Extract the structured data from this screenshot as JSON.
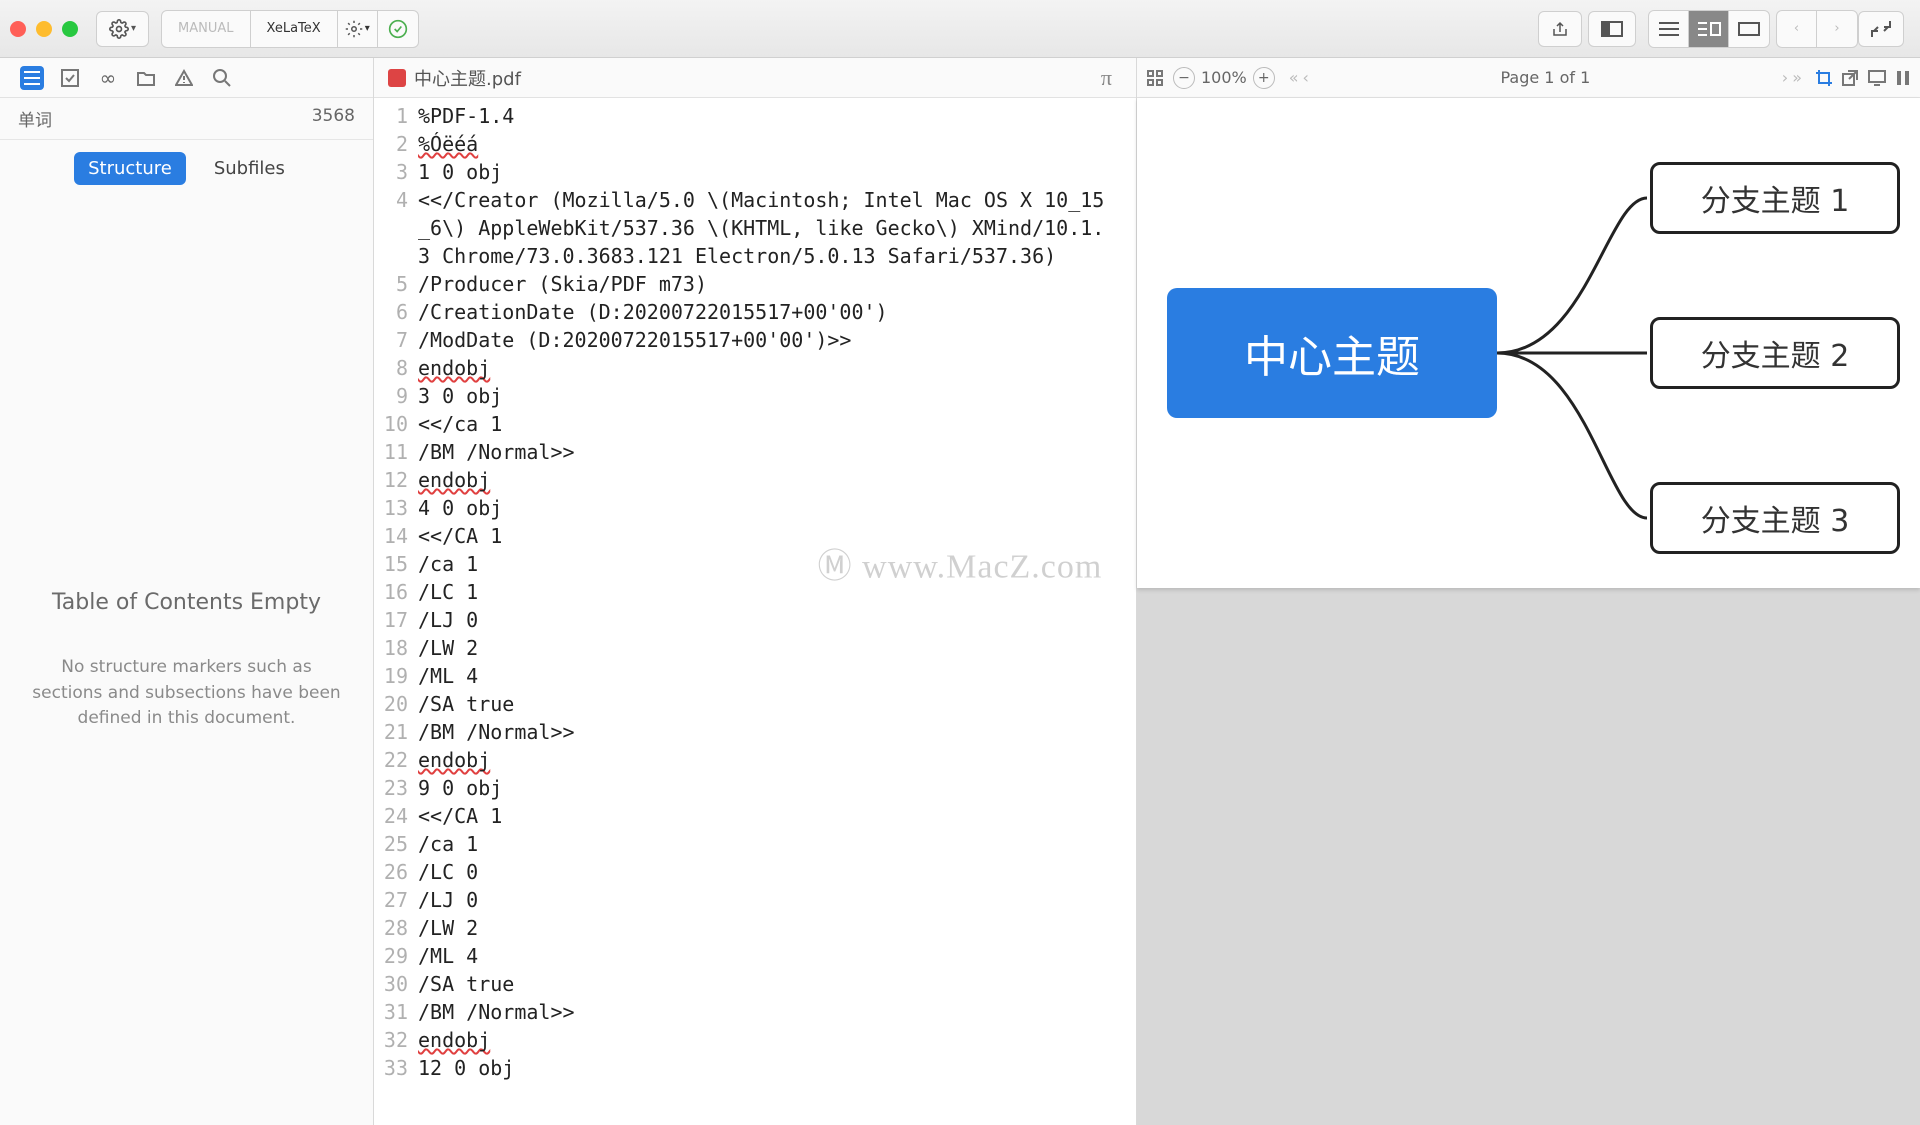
{
  "toolbar": {
    "manual": "MANUAL",
    "engine": "XeLaTeX"
  },
  "sidebar": {
    "word_label": "单词",
    "word_count": "3568",
    "tab_structure": "Structure",
    "tab_subfiles": "Subfiles",
    "empty_title": "Table of Contents Empty",
    "empty_body": "No structure markers such as sections and subsections have been defined in this document."
  },
  "editor": {
    "filename": "中心主题.pdf",
    "pi_symbol": "π",
    "lines": [
      {
        "n": "1",
        "t": "%PDF-1.4",
        "sq": false
      },
      {
        "n": "2",
        "t": "%Óëéá",
        "sq": true
      },
      {
        "n": "3",
        "t": "1 0 obj",
        "sq": false
      },
      {
        "n": "4",
        "t": "<</Creator (Mozilla/5.0 \\(Macintosh; Intel Mac OS X 10_15_6\\) AppleWebKit/537.36 \\(KHTML, like Gecko\\) XMind/10.1.3 Chrome/73.0.3683.121 Electron/5.0.13 Safari/537.36)",
        "sq": false
      },
      {
        "n": "5",
        "t": "/Producer (Skia/PDF m73)",
        "sq": false
      },
      {
        "n": "6",
        "t": "/CreationDate (D:20200722015517+00'00')",
        "sq": false
      },
      {
        "n": "7",
        "t": "/ModDate (D:20200722015517+00'00')>>",
        "sq": false
      },
      {
        "n": "8",
        "t": "endobj",
        "sq": true
      },
      {
        "n": "9",
        "t": "3 0 obj",
        "sq": false
      },
      {
        "n": "10",
        "t": "<</ca 1",
        "sq": false
      },
      {
        "n": "11",
        "t": "/BM /Normal>>",
        "sq": false
      },
      {
        "n": "12",
        "t": "endobj",
        "sq": true
      },
      {
        "n": "13",
        "t": "4 0 obj",
        "sq": false
      },
      {
        "n": "14",
        "t": "<</CA 1",
        "sq": false
      },
      {
        "n": "15",
        "t": "/ca 1",
        "sq": false
      },
      {
        "n": "16",
        "t": "/LC 1",
        "sq": false
      },
      {
        "n": "17",
        "t": "/LJ 0",
        "sq": false
      },
      {
        "n": "18",
        "t": "/LW 2",
        "sq": false
      },
      {
        "n": "19",
        "t": "/ML 4",
        "sq": false
      },
      {
        "n": "20",
        "t": "/SA true",
        "sq": false
      },
      {
        "n": "21",
        "t": "/BM /Normal>>",
        "sq": false
      },
      {
        "n": "22",
        "t": "endobj",
        "sq": true
      },
      {
        "n": "23",
        "t": "9 0 obj",
        "sq": false
      },
      {
        "n": "24",
        "t": "<</CA 1",
        "sq": false
      },
      {
        "n": "25",
        "t": "/ca 1",
        "sq": false
      },
      {
        "n": "26",
        "t": "/LC 0",
        "sq": false
      },
      {
        "n": "27",
        "t": "/LJ 0",
        "sq": false
      },
      {
        "n": "28",
        "t": "/LW 2",
        "sq": false
      },
      {
        "n": "29",
        "t": "/ML 4",
        "sq": false
      },
      {
        "n": "30",
        "t": "/SA true",
        "sq": false
      },
      {
        "n": "31",
        "t": "/BM /Normal>>",
        "sq": false
      },
      {
        "n": "32",
        "t": "endobj",
        "sq": true
      },
      {
        "n": "33",
        "t": "12 0 obj",
        "sq": false
      }
    ]
  },
  "preview": {
    "zoom": "100%",
    "page_text": "Page 1 of 1",
    "central": "中心主题",
    "branches": [
      "分支主题 1",
      "分支主题 2",
      "分支主题 3"
    ]
  },
  "watermark": "Ⓜ www.MacZ.com"
}
